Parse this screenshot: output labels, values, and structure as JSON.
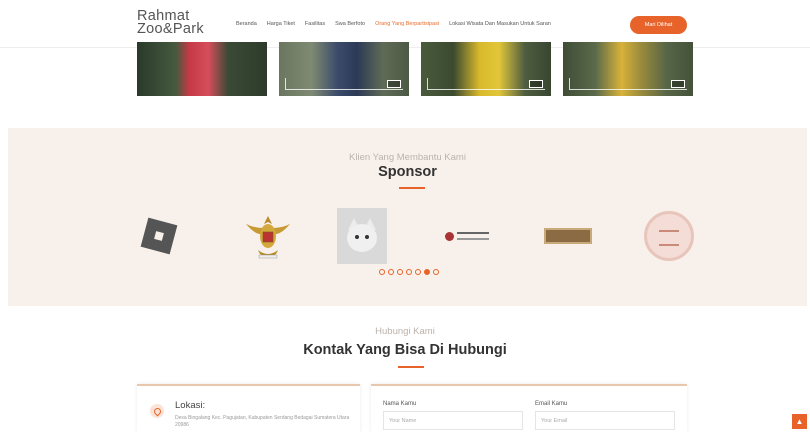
{
  "brand": {
    "line1": "Rahmat",
    "line2": "Zoo&Park"
  },
  "nav": {
    "items": [
      "Beranda",
      "Harga Tiket",
      "Fasilitas",
      "Swa Berfoto",
      "Orang Yang Berpartisipasi",
      "Lokasi Wisata Dan Masukan Untuk Saran"
    ],
    "active_index": 4,
    "cta_label": "Mari Dilihat"
  },
  "sponsor": {
    "subtitle": "Klien Yang Membantu Kami",
    "title": "Sponsor",
    "carousel_total": 7,
    "carousel_active": 5
  },
  "contact": {
    "subtitle": "Hubungi Kami",
    "title": "Kontak Yang Bisa Di Hubungi",
    "location_title": "Lokasi:",
    "location_text": "Desa Bingalang Kec. Pagujatan, Kabupaten Serdang Bedagai Sumatera Utara 20986",
    "name_label": "Nama Kamu",
    "name_placeholder": "Your Name",
    "email_label": "Email Kamu",
    "email_placeholder": "Your Email"
  },
  "colors": {
    "accent": "#e8632a",
    "section_bg": "#f8f1eb"
  },
  "icons": {
    "location": "map-pin-icon",
    "scroll_top": "arrow-up-icon"
  }
}
